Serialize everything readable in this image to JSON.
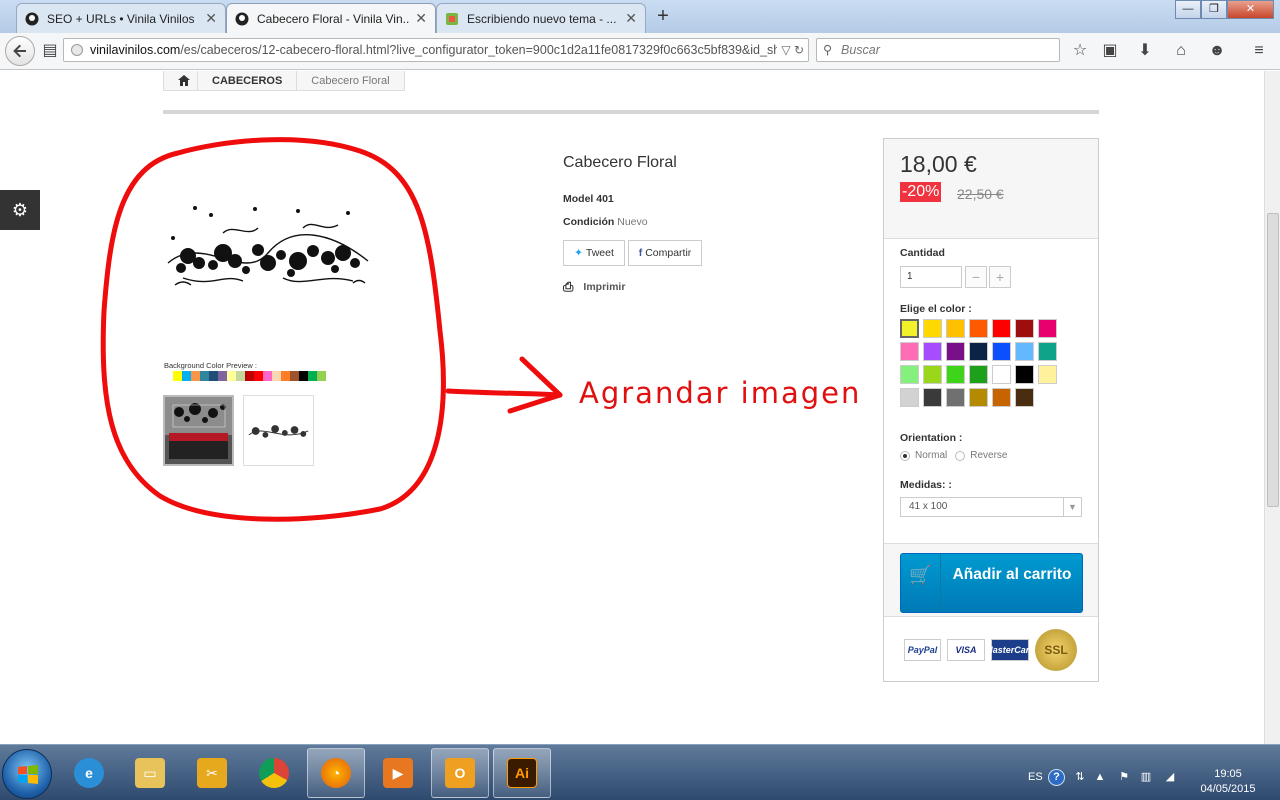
{
  "browser": {
    "tabs": [
      {
        "label": "SEO + URLs • Vinila Vinilos"
      },
      {
        "label": "Cabecero Floral - Vinila Vin..."
      },
      {
        "label": "Escribiendo nuevo tema - ..."
      }
    ],
    "window_controls": {
      "minimize": "—",
      "restore": "❐",
      "close": "✕"
    },
    "url": {
      "domain": "vinilavinilos.com",
      "path": "/es/cabeceros/12-cabecero-floral.html?live_configurator_token=900c1d2a11fe0817329f0c663c5bf839&id_shop="
    },
    "search_placeholder": "Buscar"
  },
  "breadcrumb": {
    "category": "CABECEROS",
    "current": "Cabecero Floral"
  },
  "product": {
    "bg_preview_label": "Background Color Preview :",
    "bg_swatches": [
      "#ffff00",
      "#00b0f0",
      "#f79646",
      "#31859c",
      "#1f4e79",
      "#8064a2",
      "#ffff99",
      "#c3d69b",
      "#c00000",
      "#ff0000",
      "#ff66cc",
      "#fcd5b4",
      "#fd7d24",
      "#a0522d",
      "#000000",
      "#00b050",
      "#92d050"
    ],
    "title": "Cabecero Floral",
    "model_label": "Model 401",
    "condition_label": "Condición",
    "condition_value": "Nuevo",
    "tweet_label": "Tweet",
    "share_label": "Compartir",
    "print_label": "Imprimir"
  },
  "annotation": {
    "text": "Agrandar imagen"
  },
  "buybox": {
    "price": "18,00 €",
    "discount": "-20%",
    "old_price": "22,50 €",
    "quantity_label": "Cantidad",
    "quantity_value": "1",
    "minus": "−",
    "plus": "+",
    "color_label": "Elige el color :",
    "colors": [
      "#f2f22a",
      "#ffd800",
      "#ffc000",
      "#ff5a00",
      "#ff0000",
      "#9e0e0e",
      "#e8006e",
      "#ff6eb4",
      "#a64dff",
      "#7a0f8a",
      "#0b2347",
      "#0b4fff",
      "#63b9ff",
      "#0fa38a",
      "#86f07e",
      "#9ad61a",
      "#3dd41a",
      "#1ea01a",
      "#ffffff",
      "#000000",
      "#fff29c",
      "#d2d2d2",
      "#3a3a3a",
      "#707070",
      "#b48a00",
      "#c86400",
      "#4a2c10"
    ],
    "orientation_label": "Orientation :",
    "orientation_normal": "Normal",
    "orientation_reverse": "Reverse",
    "size_label": "Medidas: :",
    "size_value": "41 x 100",
    "cart_button": "Añadir al carrito",
    "ssl_label": "SSL"
  },
  "taskbar": {
    "language": "ES",
    "time": "19:05",
    "date": "04/05/2015"
  }
}
